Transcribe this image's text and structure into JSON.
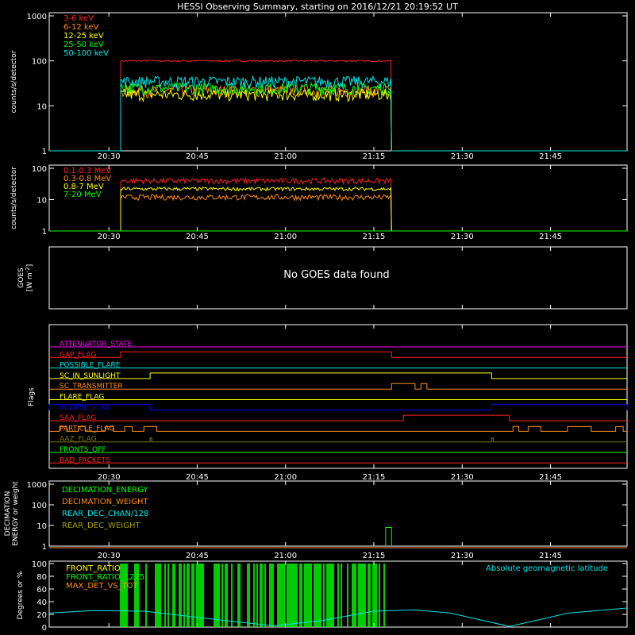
{
  "title": "HESSI Observing Summary, starting on 2016/12/21 20:19:52 UT",
  "time_ticks": [
    "20:30",
    "20:45",
    "21:00",
    "21:15",
    "21:30",
    "21:45"
  ],
  "chart_data": [
    {
      "type": "line",
      "name": "lo-energy-rates",
      "ylabel": "counts/s/detector",
      "yscale": "log",
      "ylim": [
        1,
        1000
      ],
      "ytick_labels": [
        "1",
        "10",
        "100",
        "1000"
      ],
      "xlim": [
        "20:19:52",
        "21:58"
      ],
      "series": [
        {
          "name": "3-6 keV",
          "color": "#ff2020",
          "profile": [
            [
              "20:19:52",
              1
            ],
            [
              "20:32",
              1
            ],
            [
              "20:32",
              100
            ],
            [
              "21:18",
              100
            ],
            [
              "21:18",
              1
            ],
            [
              "21:58",
              1
            ]
          ]
        },
        {
          "name": "6-12 keV",
          "color": "#ff8c1a",
          "profile": [
            [
              "20:19:52",
              1
            ],
            [
              "20:32",
              1
            ],
            [
              "20:32",
              22
            ],
            [
              "21:18",
              22
            ],
            [
              "21:18",
              1
            ],
            [
              "21:58",
              1
            ]
          ]
        },
        {
          "name": "12-25 keV",
          "color": "#ffff00",
          "profile": [
            [
              "20:19:52",
              1
            ],
            [
              "20:32",
              1
            ],
            [
              "20:32",
              18
            ],
            [
              "21:18",
              20
            ],
            [
              "21:18",
              1
            ],
            [
              "21:58",
              1
            ]
          ]
        },
        {
          "name": "25-50 keV",
          "color": "#00ff00",
          "profile": [
            [
              "20:19:52",
              1
            ],
            [
              "20:32",
              1
            ],
            [
              "20:32",
              25
            ],
            [
              "21:18",
              27
            ],
            [
              "21:18",
              1
            ],
            [
              "21:58",
              1
            ]
          ]
        },
        {
          "name": "50-100 keV",
          "color": "#00e5e5",
          "profile": [
            [
              "20:19:52",
              1
            ],
            [
              "20:32",
              1
            ],
            [
              "20:32",
              35
            ],
            [
              "21:18",
              40
            ],
            [
              "21:18",
              1
            ],
            [
              "21:58",
              1
            ]
          ]
        }
      ]
    },
    {
      "type": "line",
      "name": "hi-energy-rates",
      "ylabel": "counts/s/detector",
      "yscale": "log",
      "ylim": [
        1,
        100
      ],
      "ytick_labels": [
        "1",
        "10",
        "100"
      ],
      "series": [
        {
          "name": "0.1-0.3 MeV",
          "color": "#ff2020",
          "profile": [
            [
              "20:19:52",
              1
            ],
            [
              "20:32",
              1
            ],
            [
              "20:32",
              40
            ],
            [
              "21:18",
              40
            ],
            [
              "21:18",
              1
            ],
            [
              "21:58",
              1
            ]
          ]
        },
        {
          "name": "0.3-0.8 MeV",
          "color": "#ff8c1a",
          "profile": [
            [
              "20:19:52",
              1
            ],
            [
              "20:32",
              1
            ],
            [
              "20:32",
              12
            ],
            [
              "21:18",
              12
            ],
            [
              "21:18",
              1
            ],
            [
              "21:58",
              1
            ]
          ]
        },
        {
          "name": "0.8-7 MeV",
          "color": "#ffff00",
          "profile": [
            [
              "20:19:52",
              1
            ],
            [
              "20:32",
              1
            ],
            [
              "20:32",
              22
            ],
            [
              "21:18",
              25
            ],
            [
              "21:18",
              1
            ],
            [
              "21:58",
              1
            ]
          ]
        },
        {
          "name": "7-20 MeV",
          "color": "#00ff00",
          "profile": []
        }
      ]
    },
    {
      "type": "line",
      "name": "goes",
      "ylabel": "GOES",
      "ylabel2": "[W m",
      "ylabel2_sup": "-2",
      "ylabel2_end": "]",
      "message": "No GOES data found"
    },
    {
      "type": "line",
      "name": "flags",
      "ylabel": "Flags",
      "flags": [
        {
          "name": "ATTENUATOR_STATE",
          "color": "#ff00ff",
          "segments": []
        },
        {
          "name": "GAP_FLAG",
          "color": "#ff2020",
          "segments": [
            [
              "20:32",
              "21:18"
            ]
          ]
        },
        {
          "name": "POSSIBLE_FLARE",
          "color": "#00e5e5",
          "segments": []
        },
        {
          "name": "SC_IN_SUNLIGHT",
          "color": "#ffff00",
          "segments": [
            [
              "20:37",
              "21:35"
            ]
          ]
        },
        {
          "name": "SC_TRANSMITTER",
          "color": "#ff8c1a",
          "segments": [
            [
              "21:18",
              "21:22"
            ],
            [
              "21:23",
              "21:24"
            ]
          ]
        },
        {
          "name": "FLARE_FLAG",
          "color": "#ffff00",
          "segments": []
        },
        {
          "name": "ECLIPSE_FLAG",
          "color": "#0000ff",
          "segments": [
            [
              "20:19:52",
              "20:37"
            ],
            [
              "21:35",
              "21:58"
            ]
          ]
        },
        {
          "name": "SAA_FLAG",
          "color": "#ff2020",
          "segments": [
            [
              "21:20",
              "21:38"
            ]
          ]
        },
        {
          "name": "PARTICLE_FLAG",
          "color": "#ff8c1a",
          "segments": []
        },
        {
          "name": "AAZ_FLAG",
          "color": "#7a7a00",
          "segments": []
        },
        {
          "name": "FRONTS_OFF",
          "color": "#00ff00",
          "segments": []
        },
        {
          "name": "BAD_PACKETS",
          "color": "#ff2020",
          "segments": []
        }
      ]
    },
    {
      "type": "line",
      "name": "decimation",
      "ylabel": "DECIMATION",
      "ylabel2": "ENERGY or weight",
      "yscale": "log",
      "ylim": [
        1,
        1000
      ],
      "ytick_labels": [
        "1",
        "10",
        "100",
        "1000"
      ],
      "series": [
        {
          "name": "DECIMATION_ENERGY",
          "color": "#00ff00",
          "events": [
            [
              "21:18",
              8
            ]
          ]
        },
        {
          "name": "DECIMATION_WEIGHT",
          "color": "#ff8c1a",
          "events": [
            [
              "21:18",
              1
            ]
          ]
        },
        {
          "name": "REAR_DEC_CHAN/128",
          "color": "#00e5e5",
          "events": []
        },
        {
          "name": "REAR_DEC_WEIGHT",
          "color": "#a0a000",
          "events": []
        }
      ]
    },
    {
      "type": "line",
      "name": "ratio",
      "ylabel": "Degrees or %",
      "ylim": [
        0,
        100
      ],
      "ytick_labels": [
        "0",
        "20",
        "40",
        "60",
        "80",
        "100"
      ],
      "annotation": "Absolute geomagnetic latitude",
      "series": [
        {
          "name": "FRONT_RATIO",
          "color": "#ffff00"
        },
        {
          "name": "FRONT_RATIO_1225",
          "color": "#00ff00"
        },
        {
          "name": "MAX_DET_VS_TOT",
          "color": "#ff8c1a"
        }
      ],
      "geomag_latitude": [
        [
          "20:19:52",
          22
        ],
        [
          "20:27",
          26
        ],
        [
          "20:36",
          25
        ],
        [
          "20:50",
          10
        ],
        [
          "20:58",
          2
        ],
        [
          "21:06",
          10
        ],
        [
          "21:15",
          25
        ],
        [
          "21:22",
          27
        ],
        [
          "21:28",
          22
        ],
        [
          "21:38",
          1
        ],
        [
          "21:48",
          22
        ],
        [
          "21:58",
          30
        ]
      ]
    }
  ]
}
